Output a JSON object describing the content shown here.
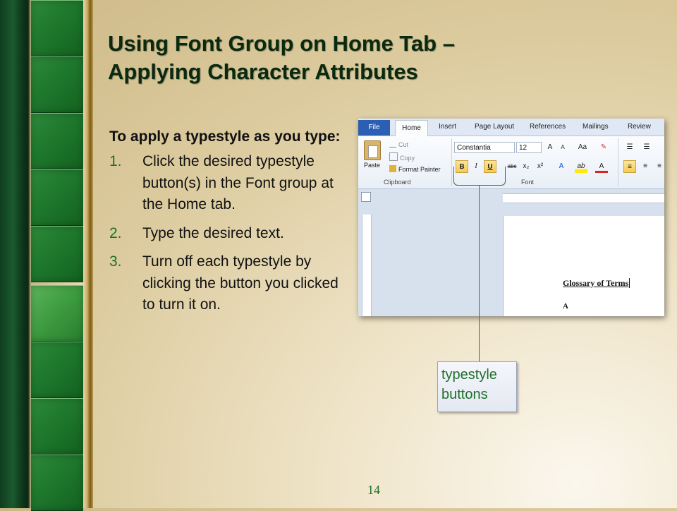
{
  "slide": {
    "title_line1": "Using Font Group on Home Tab –",
    "title_line2": "Applying Character Attributes",
    "intro": "To apply a typestyle as you type:",
    "steps": [
      {
        "num": "1.",
        "text": "Click the desired typestyle button(s) in the Font group at the Home tab."
      },
      {
        "num": "2.",
        "text": "Type the desired text."
      },
      {
        "num": "3.",
        "text": "Turn off each typestyle by clicking the button you clicked to turn it on."
      }
    ],
    "page_number": "14",
    "callout": "typestyle buttons"
  },
  "word": {
    "tabs": [
      "File",
      "Home",
      "Insert",
      "Page Layout",
      "References",
      "Mailings",
      "Review"
    ],
    "clipboard": {
      "paste": "Paste",
      "cut": "Cut",
      "copy": "Copy",
      "format_painter": "Format Painter",
      "label": "Clipboard"
    },
    "font": {
      "name": "Constantia",
      "size": "12",
      "label": "Font",
      "buttons": {
        "bold": "B",
        "italic": "I",
        "underline": "U",
        "strike": "abc",
        "subscript": "x₂",
        "superscript": "x²",
        "grow": "A",
        "shrink": "A",
        "change_case": "Aa",
        "text_effects": "A",
        "highlight": "ab",
        "font_color": "A"
      }
    },
    "document": {
      "heading": "Glossary of Terms",
      "letter": "A"
    }
  },
  "colors": {
    "accent_green": "#1e6f2a",
    "title": "#0a2a10",
    "word_file_tab": "#2b5fb4"
  }
}
